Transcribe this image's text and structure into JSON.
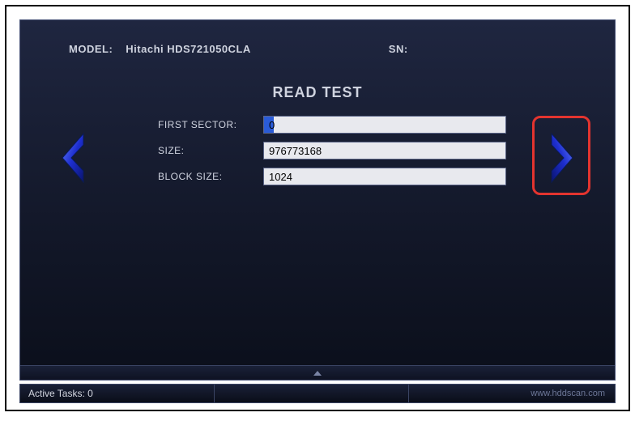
{
  "header": {
    "model_label": "MODEL:",
    "model_value": "Hitachi HDS721050CLA",
    "sn_label": "SN:",
    "sn_value": ""
  },
  "title": "READ TEST",
  "form": {
    "first_sector": {
      "label": "FIRST SECTOR:",
      "value": "0"
    },
    "size": {
      "label": "SIZE:",
      "value": "976773168"
    },
    "block_size": {
      "label": "BLOCK SIZE:",
      "value": "1024"
    }
  },
  "status": {
    "active_tasks_label": "Active Tasks: 0",
    "site": "www.hddscan.com"
  },
  "colors": {
    "highlight": "#e3342f",
    "arrow": "#2a3fc7"
  }
}
